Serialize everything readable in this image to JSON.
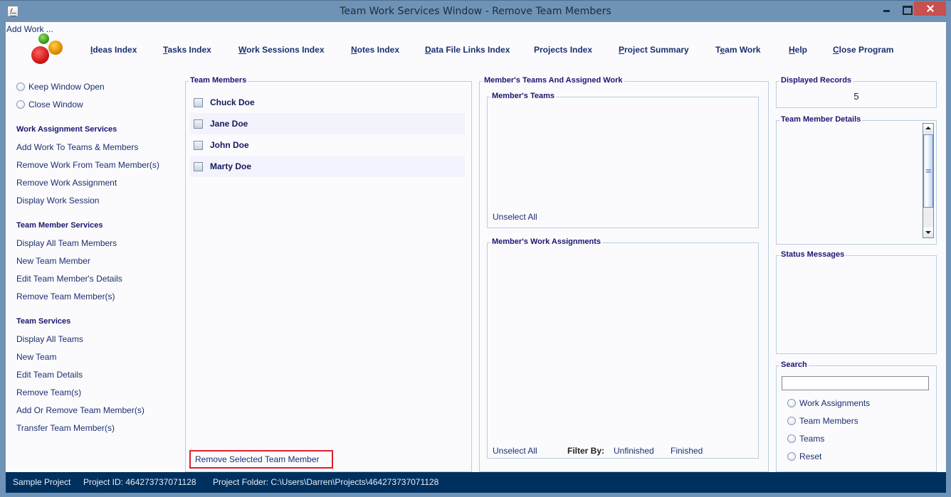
{
  "window": {
    "title": "Team Work Services Window - Remove Team Members",
    "controls": [
      "minimize",
      "maximize",
      "close"
    ]
  },
  "header": {
    "add_work_label": "Add Work ...",
    "nav": [
      {
        "label": "Ideas Index",
        "mnemonic": "I"
      },
      {
        "label": "Tasks Index",
        "mnemonic": "T"
      },
      {
        "label": "Work Sessions Index",
        "mnemonic": "W"
      },
      {
        "label": "Notes Index",
        "mnemonic": "N"
      },
      {
        "label": "Data File Links Index",
        "mnemonic": "D"
      },
      {
        "label": "Projects Index",
        "mnemonic": ""
      },
      {
        "label": "Project Summary",
        "mnemonic": "P"
      },
      {
        "label": "Team Work",
        "mnemonic": "e"
      },
      {
        "label": "Help",
        "mnemonic": "H"
      },
      {
        "label": "Close Program",
        "mnemonic": "C"
      }
    ]
  },
  "sidebar": {
    "window_options": [
      {
        "label": "Keep Window Open",
        "selected": false
      },
      {
        "label": "Close Window",
        "selected": false
      }
    ],
    "sections": [
      {
        "heading": "Work Assignment Services",
        "items": [
          "Add Work To Teams & Members",
          "Remove Work From Team Member(s)",
          "Remove Work Assignment",
          "Display Work Session"
        ]
      },
      {
        "heading": "Team Member Services",
        "items": [
          "Display All Team Members",
          "New Team Member",
          "Edit Team Member's Details",
          "Remove Team Member(s)"
        ]
      },
      {
        "heading": "Team Services",
        "items": [
          "Display All Teams",
          "New Team",
          "Edit Team Details",
          "Remove Team(s)",
          "Add Or Remove Team Member(s)",
          "Transfer Team Member(s)"
        ]
      }
    ]
  },
  "team_members": {
    "title": "Team Members",
    "members": [
      {
        "name": "Chuck Doe",
        "checked": false
      },
      {
        "name": "Jane Doe",
        "checked": false
      },
      {
        "name": "John Doe",
        "checked": false
      },
      {
        "name": "Marty Doe",
        "checked": false
      }
    ],
    "remove_button": "Remove Selected Team Member"
  },
  "assigned_work": {
    "title": "Member's Teams And Assigned Work",
    "teams_title": "Member's Teams",
    "teams_unselect": "Unselect All",
    "work_title": "Member's Work Assignments",
    "work_unselect": "Unselect All",
    "filter_label": "Filter By:",
    "filter_options": [
      "Unfinished",
      "Finished"
    ]
  },
  "right_panel": {
    "records_title": "Displayed Records",
    "records_value": "5",
    "details_title": "Team Member Details",
    "status_title": "Status Messages",
    "search_title": "Search",
    "search_value": "",
    "search_options": [
      {
        "label": "Work Assignments",
        "selected": false
      },
      {
        "label": "Team Members",
        "selected": false
      },
      {
        "label": "Teams",
        "selected": false
      },
      {
        "label": "Reset",
        "selected": false
      }
    ]
  },
  "statusbar": {
    "project_name": "Sample Project",
    "project_id": "Project ID:  464273737071128",
    "project_folder": "Project Folder: C:\\Users\\Darren\\Projects\\464273737071128"
  }
}
